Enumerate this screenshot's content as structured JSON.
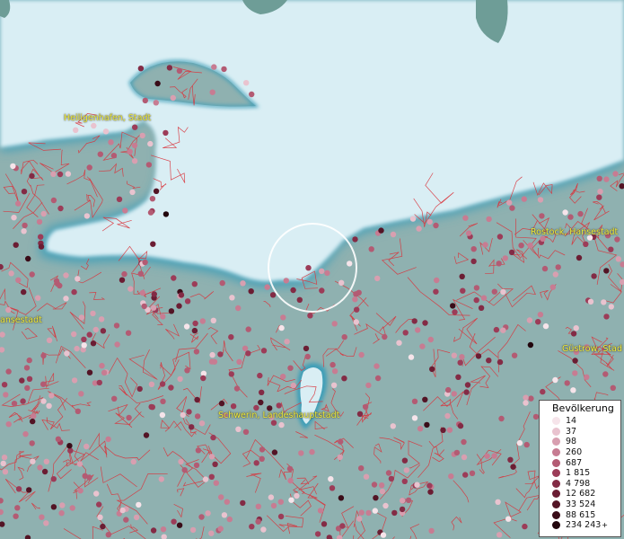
{
  "map": {
    "colors": {
      "sea": "#d9eef4",
      "sea_edge": "#3f9fb8",
      "land": "#8fb1b0",
      "borders": "#d9343c",
      "label_text": "#f3ef3a",
      "cursor_ring": "#ffffff"
    },
    "place_labels": [
      {
        "name": "Heiligenhafen, Stadt"
      },
      {
        "name": "Rostock, Hansestadt"
      },
      {
        "name": "ansestadt"
      },
      {
        "name": "Güstrow, Stad"
      },
      {
        "name": "Schwerin, Landeshauptstadt"
      }
    ]
  },
  "legend": {
    "title": "Bevölkerung",
    "items": [
      {
        "label": "14",
        "color": "#f6e4ea"
      },
      {
        "label": "37",
        "color": "#e9c3cf"
      },
      {
        "label": "98",
        "color": "#d89fb0"
      },
      {
        "label": "260",
        "color": "#c77c92"
      },
      {
        "label": "687",
        "color": "#b35b73"
      },
      {
        "label": "1 815",
        "color": "#9c3c58"
      },
      {
        "label": "4 798",
        "color": "#832b45"
      },
      {
        "label": "12 682",
        "color": "#6b1d33"
      },
      {
        "label": "33 524",
        "color": "#531425"
      },
      {
        "label": "88 615",
        "color": "#3a0c18"
      },
      {
        "label": "234 243",
        "color": "#22060d",
        "plus": "+"
      }
    ]
  }
}
